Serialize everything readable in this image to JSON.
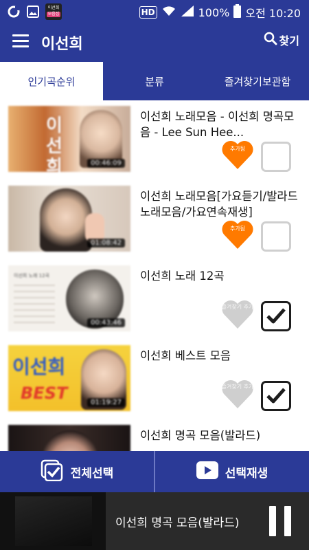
{
  "status_bar": {
    "app_badge_line1": "이선희",
    "app_badge_line2": "모음집",
    "hd": "HD",
    "battery": "100%",
    "time": "오전 10:20"
  },
  "app_bar": {
    "title": "이선희",
    "search_label": "찾기"
  },
  "tabs": [
    {
      "label": "인기곡순위",
      "active": true
    },
    {
      "label": "분류",
      "active": false
    },
    {
      "label": "즐겨찾기보관함",
      "active": false
    }
  ],
  "items": [
    {
      "title": "이선희 노래모음 - 이선희 명곡모음 - Lee Sun Hee...",
      "duration": "00:46:09",
      "thumb_text": "이 선 희",
      "heart_label": "추가됨",
      "heart_state": "added",
      "checked": false
    },
    {
      "title": "이선희 노래모음[가요듣기/발라드노래모음/가요연속재생]",
      "duration": "01:08:42",
      "thumb_text": "",
      "heart_label": "추가됨",
      "heart_state": "added",
      "checked": false
    },
    {
      "title": "이선희 노래 12곡",
      "duration": "00:43:46",
      "thumb_text": "이선희 노래 12곡",
      "heart_label": "즐겨찾기 추가",
      "heart_state": "add",
      "checked": true
    },
    {
      "title": "이선희 베스트 모음",
      "duration": "01:19:27",
      "thumb_text": "이선희",
      "thumb_text2": "BEST",
      "heart_label": "즐겨찾기 추가",
      "heart_state": "add",
      "checked": true
    },
    {
      "title": "이선희 명곡 모음(발라드)",
      "duration": "",
      "thumb_text": "",
      "heart_label": "",
      "heart_state": "none",
      "checked": false
    }
  ],
  "actions": {
    "select_all": "전체선택",
    "play_selected": "선택재생"
  },
  "player": {
    "now_playing": "이선희 명곡 모음(발라드)"
  },
  "colors": {
    "primary": "#2b3a97",
    "heart_added": "#ff7a00",
    "heart_inactive": "#cfcfcf"
  }
}
